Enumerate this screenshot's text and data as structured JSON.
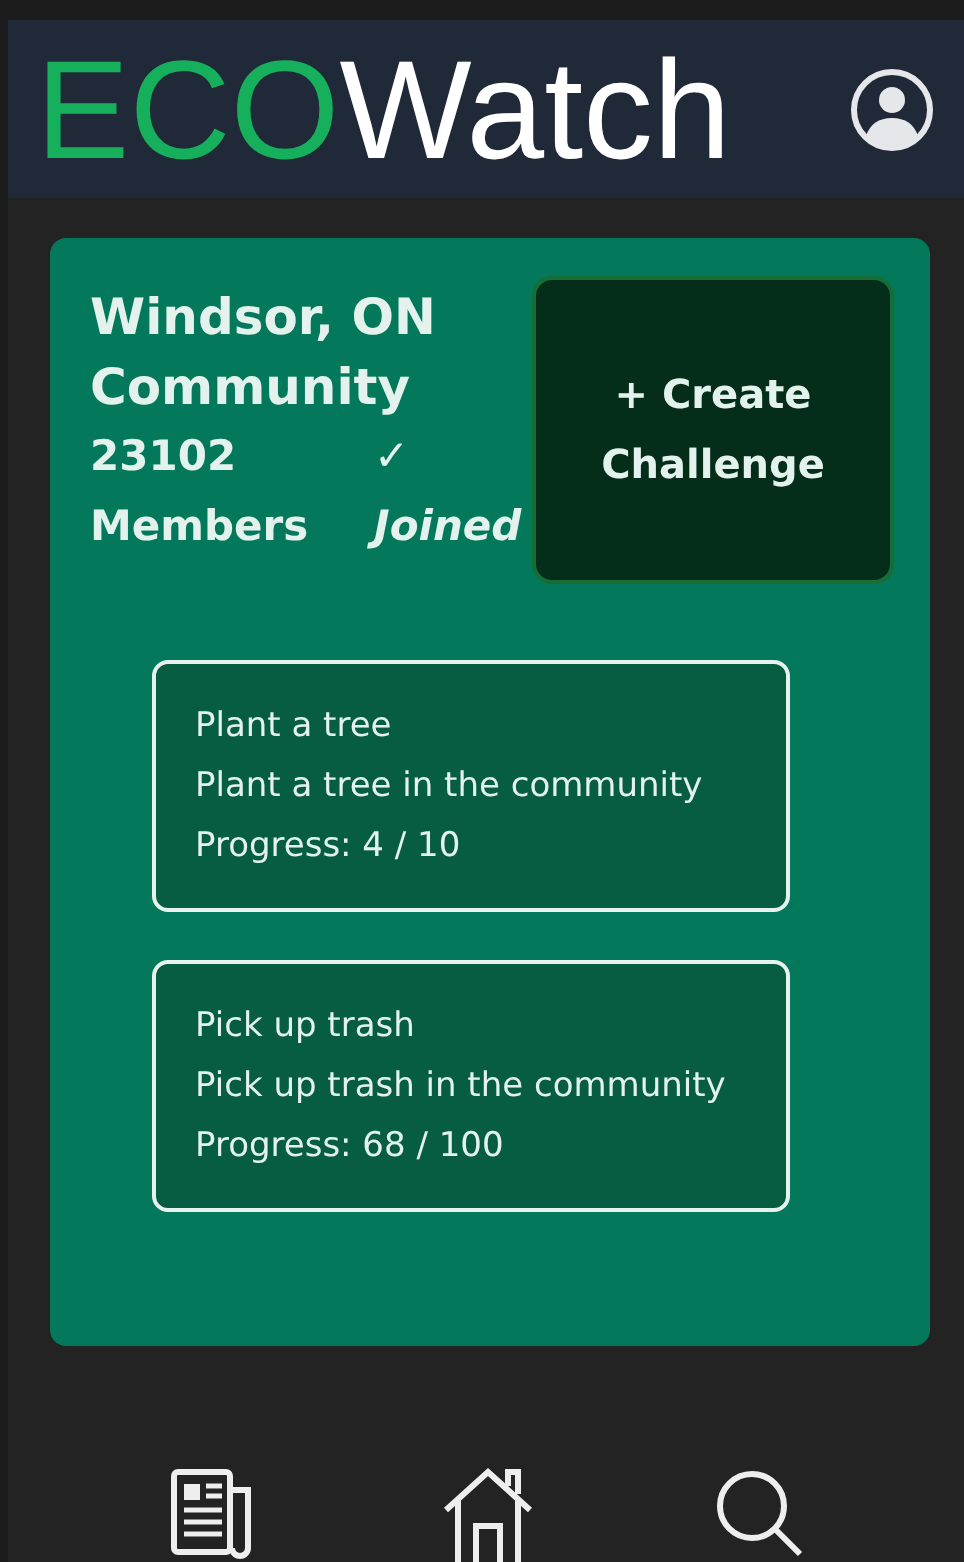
{
  "header": {
    "brand_accent": "ECO",
    "brand_rest": "Watch"
  },
  "community": {
    "name": "Windsor, ON Community",
    "members": "23102 Members",
    "joined_mark": "✓",
    "joined_label": "Joined"
  },
  "create_button": "+ Create Challenge",
  "challenges": [
    {
      "title": "Plant a tree",
      "description": "Plant a tree in the community",
      "progress": "Progress: 4 / 10"
    },
    {
      "title": "Pick up trash",
      "description": "Pick up trash in the community",
      "progress": "Progress: 68 / 100"
    }
  ],
  "bottom_nav": [
    {
      "kind": "news"
    },
    {
      "kind": "home"
    },
    {
      "kind": "search"
    }
  ]
}
